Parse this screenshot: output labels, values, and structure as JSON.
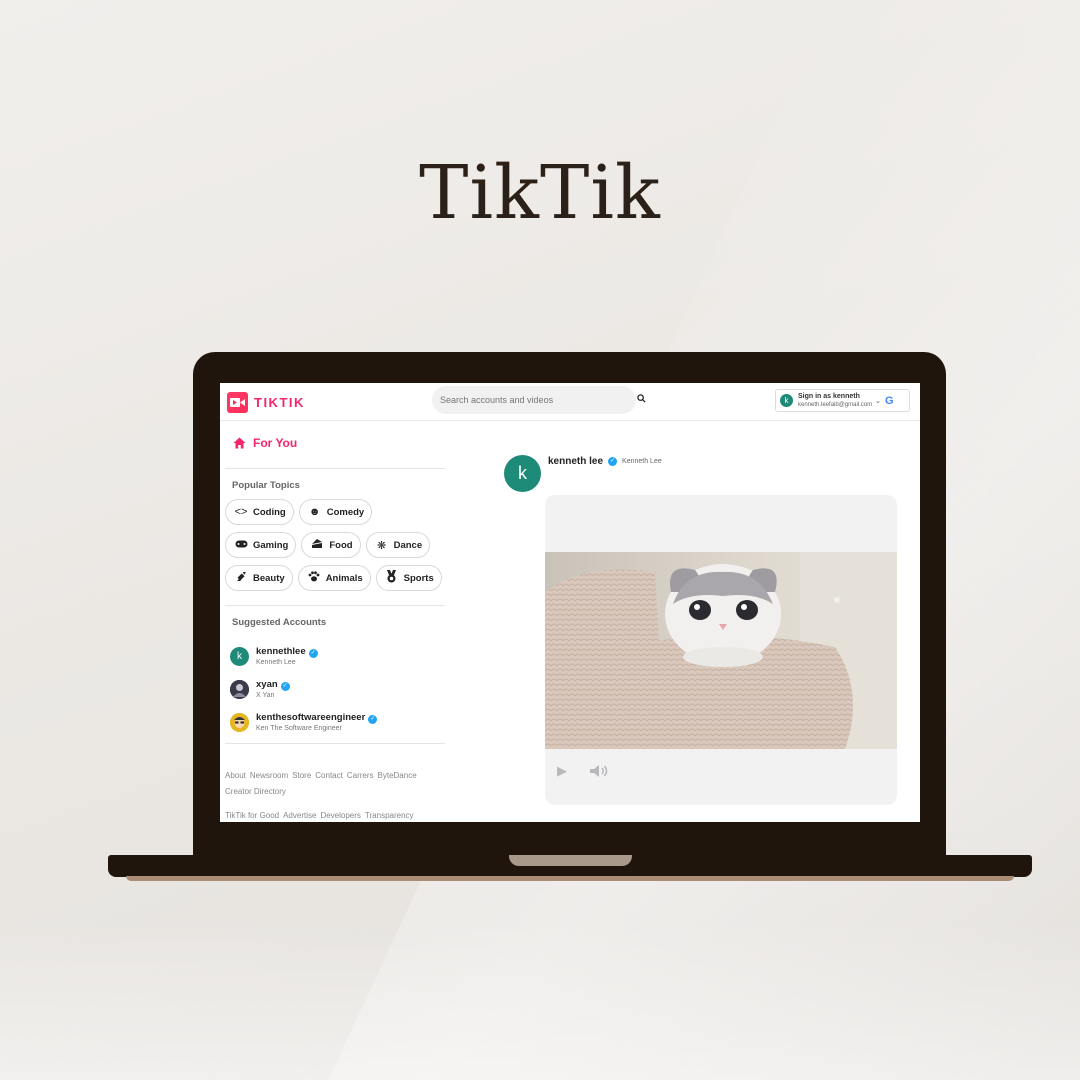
{
  "hero": {
    "title": "TikTik"
  },
  "app": {
    "logo_text": "TIKTIK",
    "search": {
      "placeholder": "Search accounts and videos"
    },
    "signin": {
      "avatar_letter": "k",
      "label": "Sign in as kenneth",
      "email": "kenneth.leefaib@gmail.com",
      "google_letter": "G"
    }
  },
  "sidebar": {
    "for_you": "For You",
    "popular_topics_title": "Popular Topics",
    "topics": [
      {
        "label": "Coding",
        "icon": "code-icon"
      },
      {
        "label": "Comedy",
        "icon": "sunglasses-face-icon"
      },
      {
        "label": "Gaming",
        "icon": "gamepad-icon"
      },
      {
        "label": "Food",
        "icon": "cake-icon"
      },
      {
        "label": "Dance",
        "icon": "dance-icon"
      },
      {
        "label": "Beauty",
        "icon": "lipstick-icon"
      },
      {
        "label": "Animals",
        "icon": "paw-icon"
      },
      {
        "label": "Sports",
        "icon": "medal-icon"
      }
    ],
    "suggested_title": "Suggested Accounts",
    "accounts": [
      {
        "handle": "kennethlee",
        "name": "Kenneth Lee",
        "avatar_letter": "k",
        "avatar_color": "#1e8a78"
      },
      {
        "handle": "xyan",
        "name": "X Yan",
        "avatar_letter": "",
        "avatar_color": "#2c2c3a"
      },
      {
        "handle": "kenthesoftwareengineer",
        "name": "Ken The Software Engineer",
        "avatar_letter": "",
        "avatar_color": "#e0b21a"
      }
    ],
    "footer_row1": [
      "About",
      "Newsroom",
      "Store",
      "Contact",
      "Carrers",
      "ByteDance"
    ],
    "footer_row2": [
      "Creator Directory"
    ],
    "footer_row3": [
      "TikTik for Good",
      "Advertise",
      "Developers",
      "Transparency"
    ]
  },
  "post": {
    "avatar_letter": "k",
    "handle": "kenneth lee",
    "name": "Kenneth Lee"
  },
  "colors": {
    "brand": "#f5256a",
    "avatar_green": "#1e8a78",
    "verified_blue": "#20a4f3",
    "laptop_body": "#1f150d"
  }
}
